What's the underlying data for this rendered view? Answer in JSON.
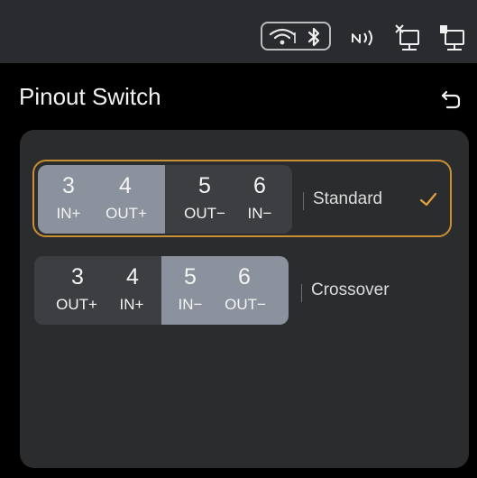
{
  "header": {
    "title": "Pinout Switch",
    "back_icon": "back-arrow-icon"
  },
  "status_bar": {
    "icons": [
      "wifi-icon",
      "bluetooth-icon",
      "nfc-icon",
      "ethernet-disconnected-icon",
      "ethernet-connected-icon"
    ]
  },
  "options": [
    {
      "label": "Standard",
      "selected": true,
      "pins": [
        {
          "num": "3",
          "signal": "IN+"
        },
        {
          "num": "4",
          "signal": "OUT+"
        },
        {
          "num": "5",
          "signal": "OUT−"
        },
        {
          "num": "6",
          "signal": "IN−"
        }
      ],
      "highlighted_pair": "left"
    },
    {
      "label": "Crossover",
      "selected": false,
      "pins": [
        {
          "num": "3",
          "signal": "OUT+"
        },
        {
          "num": "4",
          "signal": "IN+"
        },
        {
          "num": "5",
          "signal": "IN−"
        },
        {
          "num": "6",
          "signal": "OUT−"
        }
      ],
      "highlighted_pair": "right"
    }
  ],
  "colors": {
    "accent": "#c98f34",
    "highlight_pin": "#8b919d",
    "panel": "#2b2c2e",
    "status_bar": "#2a2b2e"
  }
}
